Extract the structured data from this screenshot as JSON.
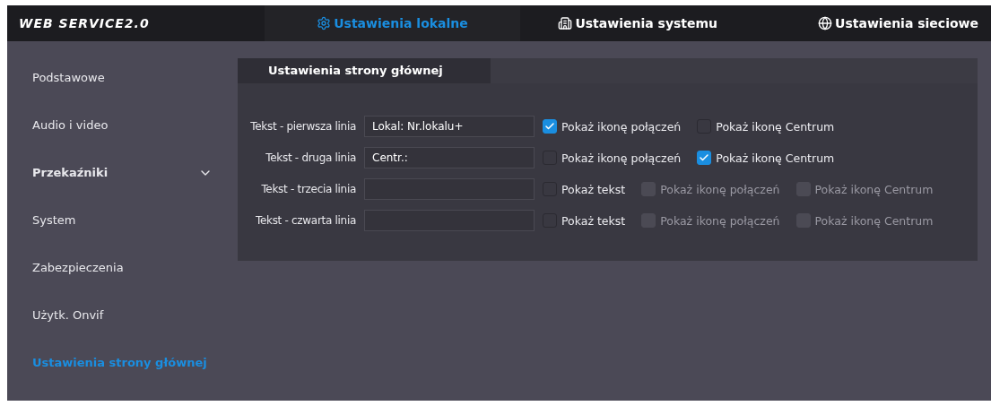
{
  "header": {
    "logo": "WEB SERVICE2.0",
    "tabs": [
      {
        "label": "Ustawienia lokalne",
        "selected": true
      },
      {
        "label": "Ustawienia systemu",
        "selected": false
      },
      {
        "label": "Ustawienia sieciowe",
        "selected": false
      }
    ]
  },
  "sidebar": {
    "items": [
      {
        "label": "Podstawowe",
        "kind": "item",
        "selected": false
      },
      {
        "label": "Audio i video",
        "kind": "item",
        "selected": false
      },
      {
        "label": "Przekaźniki",
        "kind": "group",
        "selected": false
      },
      {
        "label": "System",
        "kind": "item",
        "selected": false
      },
      {
        "label": "Zabezpieczenia",
        "kind": "item",
        "selected": false
      },
      {
        "label": "Użytk. Onvif",
        "kind": "item",
        "selected": false
      },
      {
        "label": "Ustawienia strony głównej",
        "kind": "item",
        "selected": true
      }
    ]
  },
  "panel": {
    "tab": "Ustawienia strony głównej",
    "rows": [
      {
        "label": "Tekst - pierwsza linia",
        "value": "Lokal: Nr.lokalu+",
        "options": [
          {
            "label": "Pokaż ikonę połączeń",
            "checked": true,
            "disabled": false
          },
          {
            "label": "Pokaż ikonę Centrum",
            "checked": false,
            "disabled": false
          }
        ]
      },
      {
        "label": "Tekst - druga linia",
        "value": "Centr.:",
        "options": [
          {
            "label": "Pokaż ikonę połączeń",
            "checked": false,
            "disabled": false
          },
          {
            "label": "Pokaż ikonę Centrum",
            "checked": true,
            "disabled": false
          }
        ]
      },
      {
        "label": "Tekst - trzecia linia",
        "options": [
          {
            "label": "Pokaż tekst",
            "checked": false,
            "disabled": false
          },
          {
            "label": "Pokaż ikonę połączeń",
            "checked": false,
            "disabled": true
          },
          {
            "label": "Pokaż ikonę Centrum",
            "checked": false,
            "disabled": true
          }
        ]
      },
      {
        "label": "Tekst - czwarta linia",
        "options": [
          {
            "label": "Pokaż tekst",
            "checked": false,
            "disabled": false
          },
          {
            "label": "Pokaż ikonę połączeń",
            "checked": false,
            "disabled": true
          },
          {
            "label": "Pokaż ikonę Centrum",
            "checked": false,
            "disabled": true
          }
        ]
      }
    ]
  }
}
